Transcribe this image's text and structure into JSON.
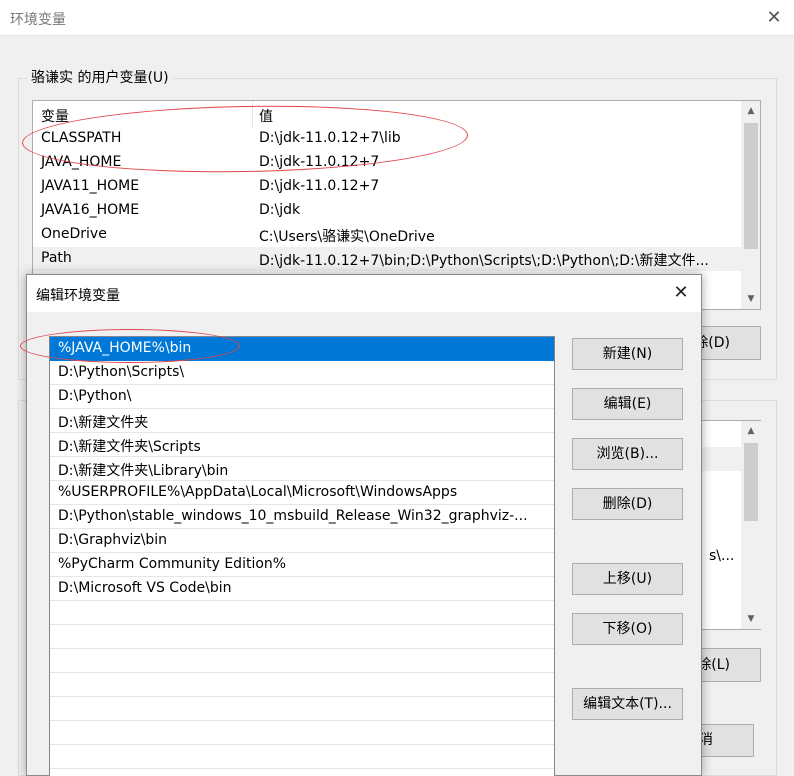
{
  "outer_window": {
    "title": "环境变量",
    "close_glyph": "✕",
    "user_group_label": "骆谦实 的用户变量(U)",
    "user_table": {
      "headers": [
        "变量",
        "值"
      ],
      "rows": [
        {
          "name": "CLASSPATH",
          "value": "D:\\jdk-11.0.12+7\\lib"
        },
        {
          "name": "JAVA_HOME",
          "value": "D:\\jdk-11.0.12+7"
        },
        {
          "name": "JAVA11_HOME",
          "value": "D:\\jdk-11.0.12+7"
        },
        {
          "name": "JAVA16_HOME",
          "value": "D:\\jdk"
        },
        {
          "name": "OneDrive",
          "value": "C:\\Users\\骆谦实\\OneDrive"
        },
        {
          "name": "Path",
          "value": "D:\\jdk-11.0.12+7\\bin;D:\\Python\\Scripts\\;D:\\Python\\;D:\\新建文件..."
        }
      ],
      "selected_row": "Path"
    },
    "visible_fragments": {
      "user_delete": "除(D)",
      "sys_value_tail": "s\\...",
      "sys_delete": "除(L)",
      "cancel": "消"
    }
  },
  "edit_dialog": {
    "title": "编辑环境变量",
    "close_glyph": "✕",
    "paths": [
      "%JAVA_HOME%\\bin",
      "D:\\Python\\Scripts\\",
      "D:\\Python\\",
      "D:\\新建文件夹",
      "D:\\新建文件夹\\Scripts",
      "D:\\新建文件夹\\Library\\bin",
      "%USERPROFILE%\\AppData\\Local\\Microsoft\\WindowsApps",
      "D:\\Python\\stable_windows_10_msbuild_Release_Win32_graphviz-...",
      "D:\\Graphviz\\bin",
      "%PyCharm Community Edition%",
      "D:\\Microsoft VS Code\\bin"
    ],
    "selected_path": "%JAVA_HOME%\\bin",
    "buttons": {
      "new": "新建(N)",
      "edit": "编辑(E)",
      "browse": "浏览(B)...",
      "delete": "删除(D)",
      "move_up": "上移(U)",
      "move_down": "下移(O)",
      "edit_text": "编辑文本(T)..."
    }
  },
  "colors": {
    "selection": "#0078d7",
    "annotation": "#e0454a"
  }
}
